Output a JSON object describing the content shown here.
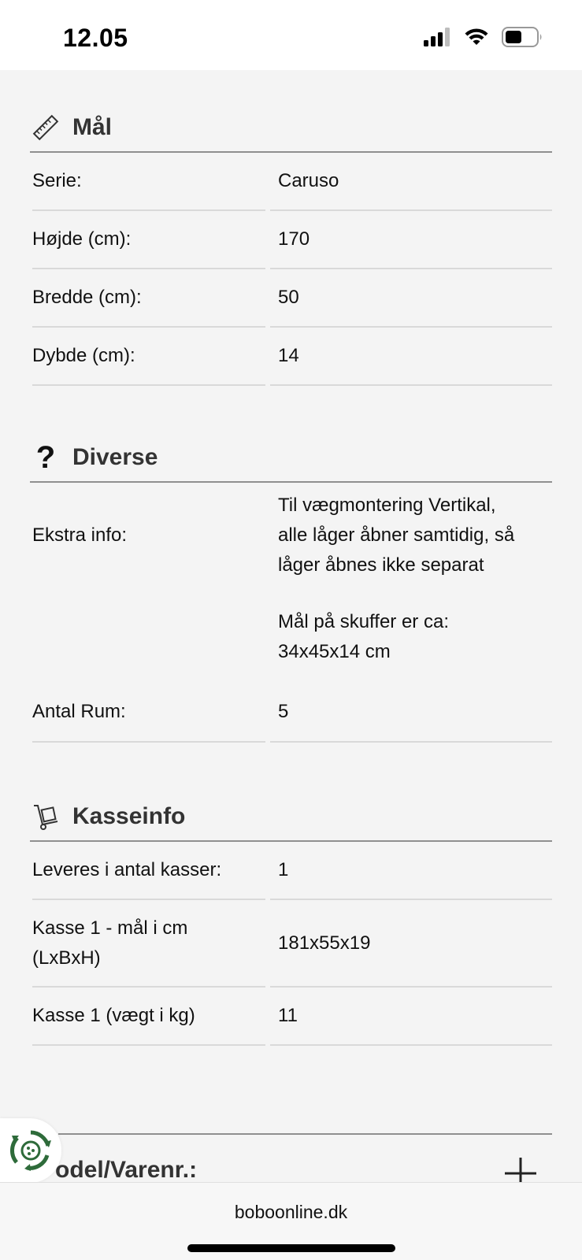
{
  "status_bar": {
    "time": "12.05"
  },
  "sections": {
    "maal": {
      "title": "Mål",
      "icon": "ruler-icon",
      "rows": [
        {
          "label": "Serie:",
          "value": "Caruso"
        },
        {
          "label": "Højde (cm):",
          "value": "170"
        },
        {
          "label": "Bredde (cm):",
          "value": "50"
        },
        {
          "label": "Dybde (cm):",
          "value": "14"
        }
      ]
    },
    "diverse": {
      "title": "Diverse",
      "icon": "question-mark-icon",
      "extra_label": "Ekstra info:",
      "extra_lines": [
        "Til vægmontering Vertikal,",
        "alle låger åbner samtidig, så",
        "låger åbnes ikke separat"
      ],
      "extra_lines2": [
        "Mål på skuffer er ca:",
        "34x45x14 cm"
      ],
      "rum_label": "Antal Rum:",
      "rum_value": "5"
    },
    "kasseinfo": {
      "title": "Kasseinfo",
      "icon": "hand-truck-icon",
      "rows": [
        {
          "label": "Leveres i antal kasser:",
          "value": "1"
        },
        {
          "label_lines": [
            "Kasse 1 - mål i cm",
            "(LxBxH)"
          ],
          "value": "181x55x19"
        },
        {
          "label": "Kasse 1 (vægt i kg)",
          "value": "11"
        }
      ]
    }
  },
  "collapsed_section": {
    "title_partial": "odel/Varenr.:",
    "icon": "plus-icon"
  },
  "eco_badge": {
    "icon": "eco-recycle-icon"
  },
  "browser": {
    "url": "boboonline.dk"
  },
  "colors": {
    "background": "#f4f4f4",
    "rule": "#8f8f8f",
    "eco_green": "#2e6b3a"
  }
}
